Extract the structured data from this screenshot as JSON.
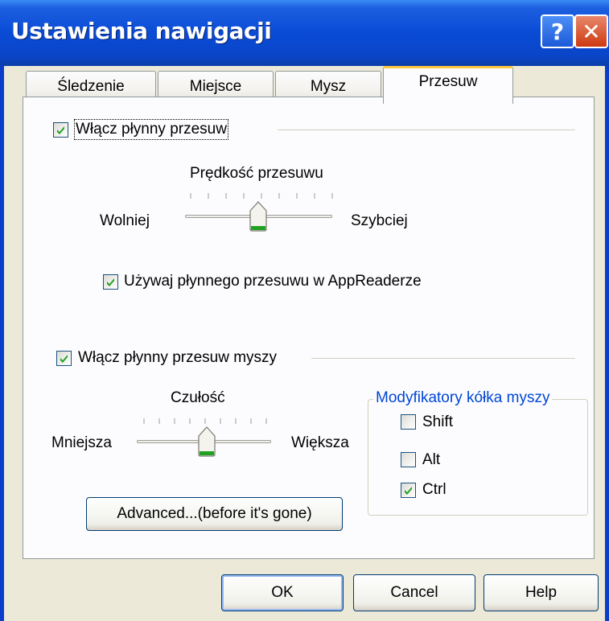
{
  "window": {
    "title": "Ustawienia nawigacji",
    "help_glyph": "?",
    "close_glyph": "✕"
  },
  "tabs": [
    {
      "label": "Śledzenie"
    },
    {
      "label": "Miejsce"
    },
    {
      "label": "Mysz"
    },
    {
      "label": "Przesuw",
      "active": true
    }
  ],
  "smooth_scroll": {
    "label": "Włącz płynny przesuw",
    "checked": true,
    "speed_title": "Prędkość przesuwu",
    "slower": "Wolniej",
    "faster": "Szybciej",
    "speed_level": 0.5,
    "appreader_label": "Używaj płynnego przesuwu w AppReaderze",
    "appreader_checked": true
  },
  "mouse_scroll": {
    "label": "Włącz płynny przesuw myszy",
    "checked": true,
    "sensitivity_title": "Czułość",
    "less": "Mniejsza",
    "more": "Większa",
    "sensitivity_level": 0.5
  },
  "modifiers": {
    "legend": "Modyfikatory kółka myszy",
    "shift": "Shift",
    "shift_checked": false,
    "alt": "Alt",
    "alt_checked": false,
    "ctrl": "Ctrl",
    "ctrl_checked": true
  },
  "advanced_button": "Advanced...(before it's gone)",
  "footer": {
    "ok": "OK",
    "cancel": "Cancel",
    "help": "Help"
  },
  "colors": {
    "titlebar": "#0a4bd6",
    "accent_tab": "#ffc83c",
    "check": "#21a121",
    "groupbox_legend": "#0046d5"
  }
}
